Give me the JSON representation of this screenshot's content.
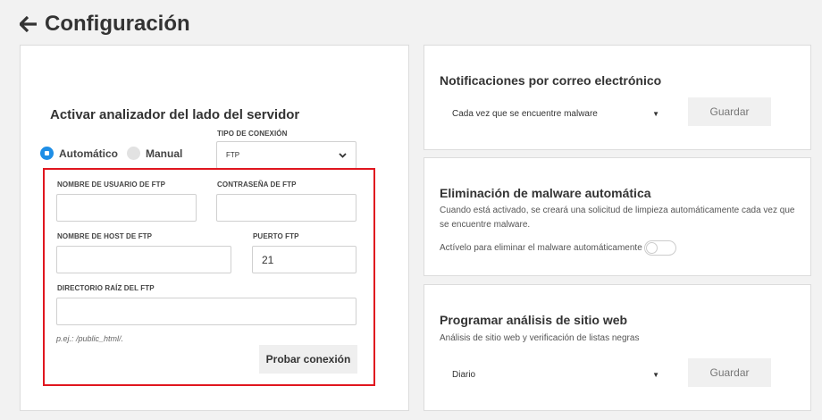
{
  "header": {
    "title": "Configuración",
    "back_icon": "arrow-left-icon"
  },
  "server_scanner": {
    "title": "Activar analizador del lado del servidor",
    "mode_options": [
      {
        "label": "Automático",
        "selected": true
      },
      {
        "label": "Manual",
        "selected": false
      }
    ],
    "connection_type_label": "TIPO DE CONEXIÓN",
    "connection_type_value": "FTP",
    "ftp_username_label": "NOMBRE DE USUARIO DE FTP",
    "ftp_username_value": "",
    "ftp_password_label": "CONTRASEÑA DE FTP",
    "ftp_password_value": "",
    "ftp_host_label": "NOMBRE DE HOST DE FTP",
    "ftp_host_value": "",
    "ftp_port_label": "PUERTO FTP",
    "ftp_port_value": "21",
    "ftp_root_label": "DIRECTORIO RAÍZ DEL FTP",
    "ftp_root_value": "",
    "ftp_root_hint": "p.ej.: /public_html/.",
    "test_button": "Probar conexión",
    "highlight_color": "#e0161f"
  },
  "email_notifications": {
    "title": "Notificaciones por correo electrónico",
    "dropdown_value": "Cada vez que se encuentre malware",
    "save_button": "Guardar"
  },
  "auto_removal": {
    "title": "Eliminación de malware automática",
    "description": "Cuando está activado, se creará una solicitud de limpieza automáticamente cada vez que se encuentre malware.",
    "toggle_label": "Actívelo para eliminar el malware automáticamente",
    "toggle_on": false
  },
  "schedule_scan": {
    "title": "Programar análisis de sitio web",
    "description": "Análisis de sitio web y verificación de listas negras",
    "dropdown_value": "Diario",
    "save_button": "Guardar"
  },
  "colors": {
    "accent": "#1e8ee6",
    "background": "#f2f2f2"
  }
}
